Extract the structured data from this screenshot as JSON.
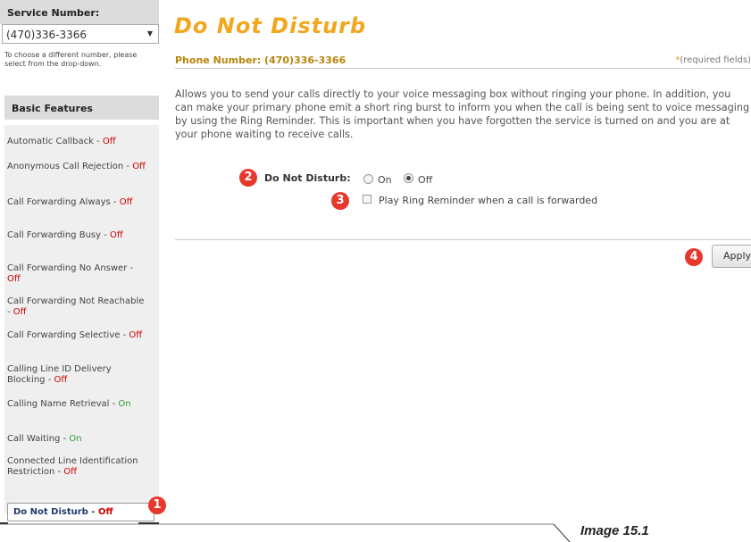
{
  "sidebar": {
    "service_number_heading": "Service Number:",
    "selected_number": "(470)336-3366",
    "hint": "To choose a different number, please select from the drop-down.",
    "basic_features_heading": "Basic Features",
    "features": [
      {
        "name": "Automatic Callback - ",
        "status": "Off"
      },
      {
        "name": "Anonymous Call Rejection - ",
        "status": "Off"
      },
      {
        "name": "Call Forwarding Always - ",
        "status": "Off"
      },
      {
        "name": "Call Forwarding Busy - ",
        "status": "Off"
      },
      {
        "name": "Call Forwarding No Answer - ",
        "status": "Off"
      },
      {
        "name": "Call Forwarding Not Reachable - ",
        "status": "Off"
      },
      {
        "name": "Call Forwarding Selective - ",
        "status": "Off"
      },
      {
        "name": "Calling Line ID Delivery Blocking - ",
        "status": "Off"
      },
      {
        "name": "Calling Name Retrieval - ",
        "status": "On"
      },
      {
        "name": "Call Waiting - ",
        "status": "On"
      },
      {
        "name": "Connected Line Identification Restriction - ",
        "status": "Off"
      }
    ],
    "active_feature": {
      "name": "Do Not Disturb - ",
      "status": "Off"
    }
  },
  "main": {
    "title": "Do Not Disturb",
    "phone_label": "Phone Number: (470)336-3366",
    "required_star": "*",
    "required_text": "(required fields)",
    "description": "Allows you to send your calls directly to your voice messaging box without ringing your phone. In addition, you can make your primary phone emit a short ring burst to inform you when the call is being sent to voice messaging by using the Ring Reminder. This is important when you have forgotten the service is turned on and you are at your phone waiting to receive calls.",
    "dnd_label": "Do Not Disturb:",
    "option_on": "On",
    "option_off": "Off",
    "selected_option": "Off",
    "ring_reminder_label": "Play Ring Reminder when a call is forwarded",
    "ring_reminder_checked": false,
    "apply_label": "Apply"
  },
  "badges": [
    "1",
    "2",
    "3",
    "4"
  ],
  "footer": {
    "caption": "Image 15.1"
  },
  "colors": {
    "title": "#f2a71e",
    "badge": "#e8372d",
    "status_off": "#cc0000",
    "status_on": "#339933",
    "phone_label": "#b8860b"
  }
}
